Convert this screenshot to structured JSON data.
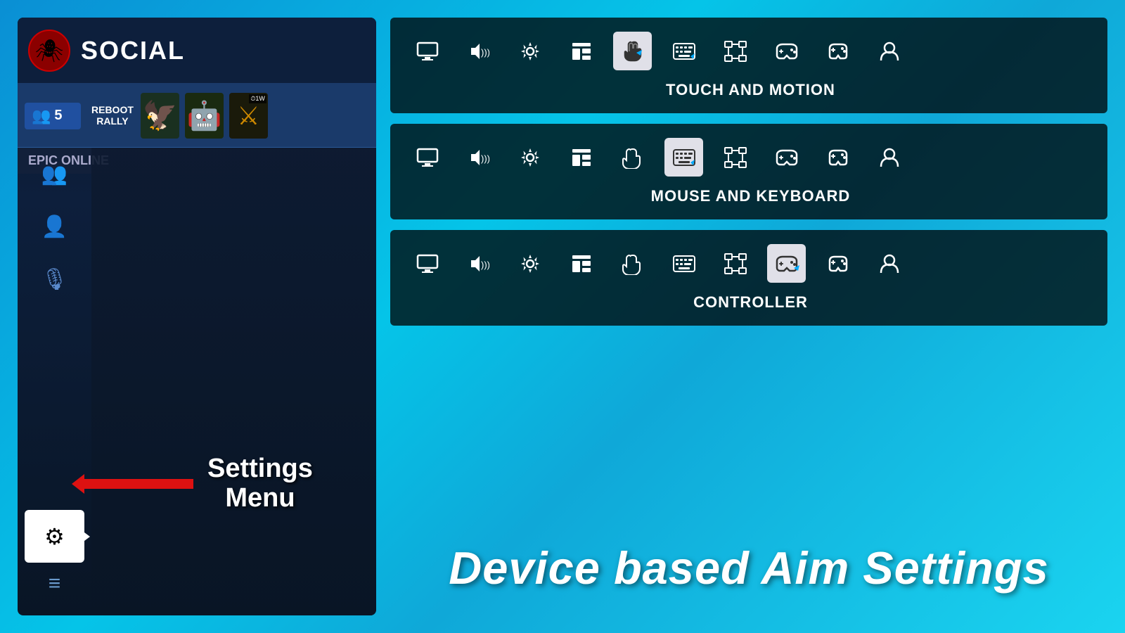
{
  "app": {
    "title": "SOCIAL",
    "logo_symbol": "🕷"
  },
  "header": {
    "friends_count": "5",
    "reboot_label": "REBOOT\nRALLY",
    "epic_online": "EPIC ONLINE"
  },
  "sidebar": {
    "icons": [
      "👥",
      "👤",
      "🎙"
    ],
    "settings_label": "⚙",
    "hamburger": "≡"
  },
  "annotation": {
    "arrow_text": "Settings\nMenu"
  },
  "settings_panels": [
    {
      "id": "touch_motion",
      "label": "TOUCH AND MOTION",
      "active_index": 4,
      "icons": [
        "monitor",
        "sound",
        "gear",
        "ui",
        "touch",
        "keyboard",
        "network",
        "controller1",
        "controller2",
        "profile"
      ]
    },
    {
      "id": "mouse_keyboard",
      "label": "MOUSE AND KEYBOARD",
      "active_index": 5,
      "icons": [
        "monitor",
        "sound",
        "gear",
        "ui",
        "touch",
        "keyboard",
        "network",
        "controller1",
        "controller2",
        "profile"
      ]
    },
    {
      "id": "controller",
      "label": "CONTROLLER",
      "active_index": 7,
      "icons": [
        "monitor",
        "sound",
        "gear",
        "ui",
        "touch",
        "keyboard",
        "network",
        "controller1",
        "controller2",
        "profile"
      ]
    }
  ],
  "bottom_label": "Device based Aim Settings"
}
